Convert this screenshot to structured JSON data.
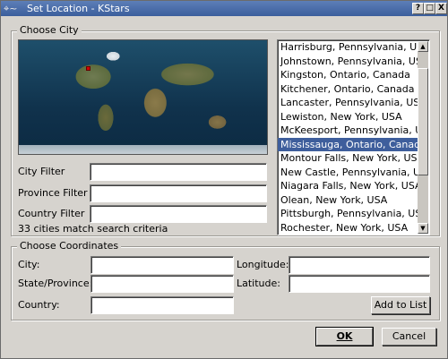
{
  "window": {
    "title": "Set Location - KStars",
    "app_icon": "⌖~",
    "help_glyph": "?",
    "maximize_glyph": "□",
    "close_glyph": "X"
  },
  "choose_city": {
    "group_title": "Choose City",
    "city_filter_label": "City Filter",
    "province_filter_label": "Province Filter",
    "country_filter_label": "Country Filter",
    "city_filter_value": "",
    "province_filter_value": "",
    "country_filter_value": "",
    "match_status": "33 cities match search criteria",
    "cities": [
      "Harrisburg, Pennsylvania, USA",
      "Johnstown, Pennsylvania, USA",
      "Kingston, Ontario, Canada",
      "Kitchener, Ontario, Canada",
      "Lancaster, Pennsylvania, USA",
      "Lewiston, New York, USA",
      "McKeesport, Pennsylvania, USA",
      "Mississauga, Ontario, Canada",
      "Montour Falls, New York, USA",
      "New Castle, Pennsylvania, USA",
      "Niagara Falls, New York, USA",
      "Olean, New York, USA",
      "Pittsburgh, Pennsylvania, USA",
      "Rochester, New York, USA"
    ],
    "selected_city": "Mississauga, Ontario, Canada"
  },
  "choose_coordinates": {
    "group_title": "Choose Coordinates",
    "city_label": "City:",
    "state_label": "State/Province:",
    "country_label": "Country:",
    "longitude_label": "Longitude:",
    "latitude_label": "Latitude:",
    "city_value": "",
    "state_value": "",
    "country_value": "",
    "longitude_value": "",
    "latitude_value": "",
    "add_button": "Add to List"
  },
  "buttons": {
    "ok": "OK",
    "cancel": "Cancel"
  },
  "icons": {
    "scroll_up": "▲",
    "scroll_down": "▼"
  },
  "colors": {
    "selection": "#3e5e9c",
    "titlebar": "#4a6ca8"
  }
}
